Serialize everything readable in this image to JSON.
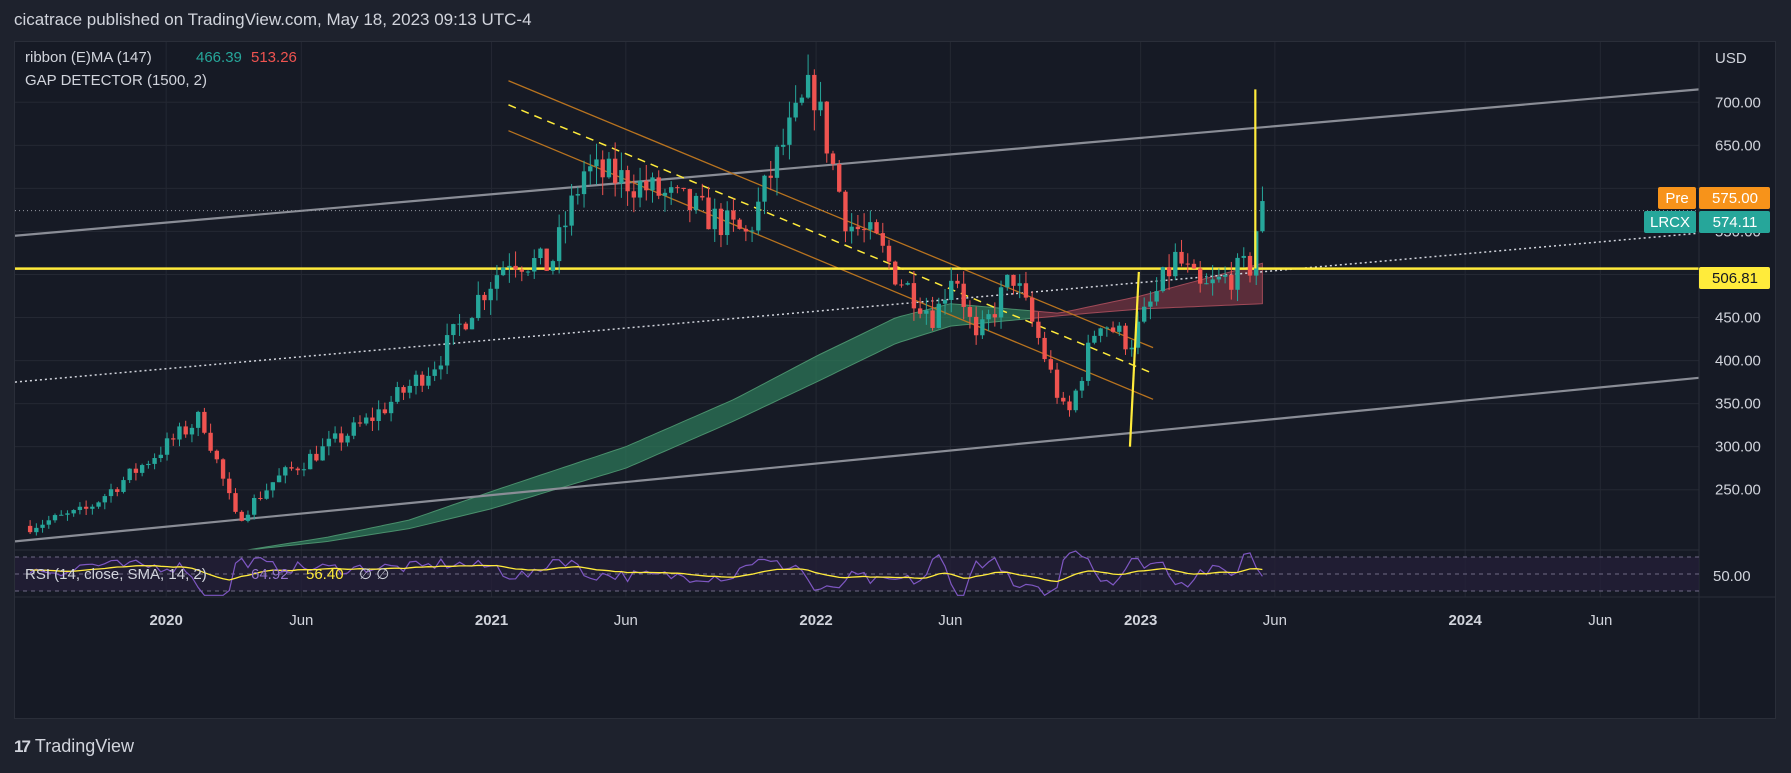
{
  "header": {
    "title": "cicatrace published on TradingView.com, May 18, 2023 09:13 UTC-4"
  },
  "footer": {
    "logo_mark": "17",
    "brand": "TradingView"
  },
  "indicators": {
    "ribbon": {
      "label": "ribbon (E)MA (147)",
      "v1": "466.39",
      "v2": "513.26",
      "v1_color": "#26a69a",
      "v2_color": "#ef5350"
    },
    "gap": {
      "label": "GAP DETECTOR (1500, 2)"
    },
    "rsi": {
      "label": "RSI (14, close, SMA, 14, 2)",
      "v1": "64.92",
      "v2": "56.40",
      "extra": "∅ ∅",
      "axis_label": "50.00"
    }
  },
  "price_axis": {
    "currency": "USD"
  },
  "tags": {
    "pre": {
      "label": "Pre",
      "value": "575.00",
      "color": "#f7931a"
    },
    "last": {
      "label": "LRCX",
      "value": "574.11",
      "color": "#26a69a"
    },
    "level": {
      "value": "506.81",
      "color": "#ffeb3b"
    }
  },
  "chart_data": {
    "type": "candlestick",
    "symbol": "LRCX",
    "currency": "USD",
    "interval": "weekly",
    "y_ticks": [
      250,
      300,
      350,
      400,
      450,
      500,
      550,
      600,
      650,
      700
    ],
    "y_tick_labels": [
      "250.00",
      "300.00",
      "350.00",
      "400.00",
      "450.00",
      "500.00",
      "550.00",
      "600.00",
      "650.00",
      "700.00"
    ],
    "ylim": [
      180,
      770
    ],
    "x_ticks": [
      "2020",
      "Jun",
      "2021",
      "Jun",
      "2022",
      "Jun",
      "2023",
      "Jun",
      "2024",
      "Jun"
    ],
    "x_tick_dates": [
      "2020-01-01",
      "2020-06-01",
      "2021-01-01",
      "2021-06-01",
      "2022-01-01",
      "2022-06-01",
      "2023-01-01",
      "2023-06-01",
      "2024-01-01",
      "2024-06-01"
    ],
    "xlim": [
      "2019-07-15",
      "2024-09-20"
    ],
    "horizontal_level": 506.81,
    "last_price": 574.11,
    "premarket_price": 575.0,
    "close_anchors": [
      [
        "2019-08-01",
        208
      ],
      [
        "2019-10-01",
        225
      ],
      [
        "2019-12-01",
        275
      ],
      [
        "2020-02-10",
        335
      ],
      [
        "2020-03-20",
        215
      ],
      [
        "2020-05-01",
        260
      ],
      [
        "2020-06-15",
        290
      ],
      [
        "2020-08-15",
        330
      ],
      [
        "2020-10-01",
        370
      ],
      [
        "2020-11-01",
        400
      ],
      [
        "2020-12-15",
        470
      ],
      [
        "2021-01-20",
        520
      ],
      [
        "2021-03-08",
        510
      ],
      [
        "2021-04-15",
        620
      ],
      [
        "2021-06-01",
        610
      ],
      [
        "2021-08-10",
        580
      ],
      [
        "2021-10-15",
        545
      ],
      [
        "2021-11-20",
        640
      ],
      [
        "2021-12-28",
        720
      ],
      [
        "2022-02-05",
        560
      ],
      [
        "2022-03-08",
        540
      ],
      [
        "2022-04-01",
        500
      ],
      [
        "2022-05-15",
        450
      ],
      [
        "2022-06-05",
        510
      ],
      [
        "2022-06-30",
        420
      ],
      [
        "2022-08-10",
        500
      ],
      [
        "2022-09-10",
        420
      ],
      [
        "2022-10-10",
        330
      ],
      [
        "2022-11-15",
        450
      ],
      [
        "2022-12-20",
        420
      ],
      [
        "2023-01-20",
        480
      ],
      [
        "2023-02-10",
        520
      ],
      [
        "2023-03-10",
        480
      ],
      [
        "2023-04-15",
        500
      ],
      [
        "2023-05-05",
        510
      ],
      [
        "2023-05-12",
        560
      ],
      [
        "2023-05-18",
        574
      ]
    ],
    "ribbon_fast_anchors": [
      [
        "2020-04-01",
        180
      ],
      [
        "2020-07-01",
        195
      ],
      [
        "2020-10-01",
        215
      ],
      [
        "2021-01-01",
        248
      ],
      [
        "2021-06-01",
        300
      ],
      [
        "2021-10-01",
        355
      ],
      [
        "2022-01-01",
        405
      ],
      [
        "2022-04-01",
        450
      ],
      [
        "2022-06-01",
        466
      ],
      [
        "2022-10-01",
        455
      ],
      [
        "2023-01-01",
        475
      ],
      [
        "2023-05-18",
        513
      ]
    ],
    "ribbon_slow_anchors": [
      [
        "2020-04-01",
        180
      ],
      [
        "2020-07-01",
        190
      ],
      [
        "2020-10-01",
        205
      ],
      [
        "2021-01-01",
        228
      ],
      [
        "2021-06-01",
        275
      ],
      [
        "2021-10-01",
        330
      ],
      [
        "2022-01-01",
        375
      ],
      [
        "2022-04-01",
        420
      ],
      [
        "2022-06-01",
        440
      ],
      [
        "2022-10-01",
        452
      ],
      [
        "2023-01-01",
        460
      ],
      [
        "2023-05-18",
        466
      ]
    ],
    "trend_lines": [
      {
        "name": "upper-channel",
        "color": "#8a8d96",
        "from": [
          "2019-07-15",
          545
        ],
        "to": [
          "2024-09-20",
          715
        ]
      },
      {
        "name": "lower-channel",
        "color": "#8a8d96",
        "from": [
          "2019-07-15",
          190
        ],
        "to": [
          "2024-09-20",
          380
        ]
      },
      {
        "name": "dotted-mid",
        "color": "#d1d4dc",
        "dash": "2,3",
        "from": [
          "2019-07-15",
          375
        ],
        "to": [
          "2024-09-20",
          548
        ]
      },
      {
        "name": "brown-channel-top",
        "color": "#b8731f",
        "from": [
          "2021-01-20",
          725
        ],
        "to": [
          "2023-01-15",
          415
        ]
      },
      {
        "name": "brown-channel-bottom",
        "color": "#b8731f",
        "from": [
          "2021-01-20",
          667
        ],
        "to": [
          "2023-01-15",
          355
        ]
      },
      {
        "name": "yellow-dashed-mid",
        "color": "#ffeb3b",
        "dash": "8,6",
        "from": [
          "2021-01-20",
          697
        ],
        "to": [
          "2023-01-15",
          385
        ]
      }
    ],
    "vertical_marks": [
      {
        "name": "gap-marker-2022-12",
        "color": "#ffeb3b",
        "from": [
          "2022-12-20",
          300
        ],
        "to": [
          "2022-12-30",
          503
        ]
      },
      {
        "name": "gap-marker-2023-05",
        "color": "#ffeb3b",
        "from": [
          "2023-05-10",
          507
        ],
        "to": [
          "2023-05-10",
          715
        ]
      }
    ],
    "rsi": {
      "label": "RSI (14, close, SMA, 14, 2)",
      "rsi_value": 64.92,
      "sma_value": 56.4,
      "level": 50
    }
  }
}
